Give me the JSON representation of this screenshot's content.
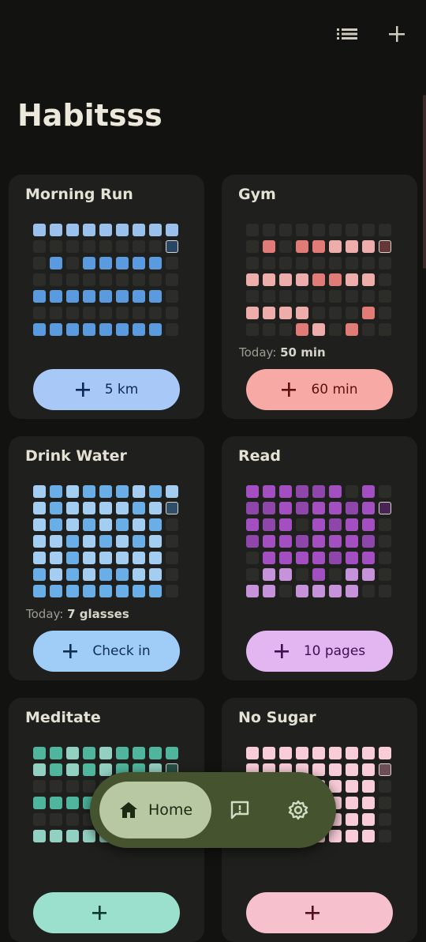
{
  "app": {
    "title": "Habitsss"
  },
  "toolbar": {
    "list_icon": "list-icon",
    "add_icon": "plus-icon"
  },
  "today_label": "Today:",
  "habits": [
    {
      "name": "Morning Run",
      "color": "#5a9be0",
      "button_label": "5 km",
      "button_bg": "#a8c8f8",
      "button_fg": "#0f2a52",
      "today_value": "",
      "grid": [
        [
          3,
          3,
          3,
          3,
          3,
          3,
          3,
          3,
          3
        ],
        [
          0,
          0,
          0,
          0,
          0,
          0,
          0,
          0,
          9
        ],
        [
          0,
          2,
          0,
          2,
          2,
          2,
          2,
          2,
          0
        ],
        [
          0,
          0,
          0,
          0,
          0,
          0,
          0,
          0,
          0
        ],
        [
          2,
          2,
          2,
          2,
          2,
          2,
          2,
          2,
          0
        ],
        [
          0,
          0,
          0,
          0,
          0,
          0,
          0,
          0,
          0
        ],
        [
          2,
          2,
          2,
          2,
          2,
          2,
          2,
          2,
          0
        ]
      ]
    },
    {
      "name": "Gym",
      "color": "#e07b78",
      "button_label": "60 min",
      "button_bg": "#f7aaa5",
      "button_fg": "#5c1210",
      "today_value": "50 min",
      "grid": [
        [
          0,
          0,
          0,
          0,
          0,
          0,
          0,
          0,
          0
        ],
        [
          0,
          2,
          0,
          2,
          2,
          3,
          3,
          3,
          9
        ],
        [
          0,
          0,
          0,
          0,
          0,
          0,
          0,
          0,
          0
        ],
        [
          3,
          3,
          3,
          3,
          2,
          2,
          3,
          3,
          0
        ],
        [
          0,
          0,
          0,
          0,
          0,
          0,
          0,
          0,
          0
        ],
        [
          3,
          3,
          3,
          3,
          0,
          0,
          0,
          2,
          0
        ],
        [
          0,
          0,
          0,
          2,
          3,
          0,
          2,
          0,
          0
        ]
      ]
    },
    {
      "name": "Drink Water",
      "color": "#6aaee8",
      "button_label": "Check in",
      "button_bg": "#9fcdf7",
      "button_fg": "#0e2f52",
      "today_value": "7 glasses",
      "grid": [
        [
          3,
          2,
          3,
          2,
          2,
          2,
          3,
          2,
          3
        ],
        [
          3,
          2,
          3,
          3,
          3,
          3,
          2,
          3,
          9
        ],
        [
          3,
          2,
          3,
          2,
          3,
          2,
          3,
          2,
          0
        ],
        [
          3,
          3,
          2,
          3,
          2,
          3,
          2,
          3,
          0
        ],
        [
          3,
          3,
          2,
          3,
          3,
          3,
          3,
          3,
          0
        ],
        [
          2,
          3,
          2,
          3,
          2,
          2,
          3,
          3,
          0
        ],
        [
          2,
          2,
          2,
          2,
          2,
          2,
          2,
          2,
          0
        ]
      ]
    },
    {
      "name": "Read",
      "color": "#a34fc2",
      "button_label": "10 pages",
      "button_bg": "#e3b6f2",
      "button_fg": "#3f0f52",
      "today_value": "",
      "grid": [
        [
          2,
          2,
          2,
          1,
          1,
          2,
          0,
          2,
          0
        ],
        [
          1,
          1,
          2,
          1,
          2,
          2,
          1,
          2,
          9
        ],
        [
          2,
          1,
          2,
          0,
          2,
          1,
          2,
          2,
          0
        ],
        [
          1,
          2,
          2,
          1,
          2,
          2,
          2,
          1,
          0
        ],
        [
          0,
          2,
          2,
          2,
          2,
          1,
          2,
          2,
          0
        ],
        [
          0,
          3,
          3,
          0,
          2,
          0,
          3,
          3,
          0
        ],
        [
          3,
          3,
          0,
          3,
          3,
          3,
          3,
          0,
          0
        ]
      ]
    },
    {
      "name": "Meditate",
      "color": "#4fb59d",
      "button_label": "",
      "button_bg": "#9be0cd",
      "button_fg": "#0f3a30",
      "today_value": "",
      "grid": [
        [
          2,
          2,
          3,
          2,
          3,
          2,
          2,
          2,
          2
        ],
        [
          3,
          2,
          3,
          2,
          3,
          2,
          2,
          3,
          9
        ],
        [
          0,
          0,
          0,
          0,
          0,
          0,
          0,
          0,
          0
        ],
        [
          2,
          2,
          2,
          2,
          2,
          2,
          2,
          2,
          0
        ],
        [
          0,
          0,
          0,
          0,
          0,
          0,
          0,
          0,
          0
        ],
        [
          3,
          3,
          3,
          3,
          3,
          3,
          3,
          3,
          0
        ]
      ]
    },
    {
      "name": "No Sugar",
      "color": "#f5aec0",
      "button_label": "",
      "button_bg": "#f7c0cd",
      "button_fg": "#521020",
      "today_value": "",
      "grid": [
        [
          3,
          3,
          3,
          3,
          3,
          3,
          3,
          3,
          3
        ],
        [
          3,
          3,
          3,
          3,
          3,
          3,
          3,
          3,
          9
        ],
        [
          3,
          3,
          3,
          3,
          3,
          3,
          3,
          3,
          0
        ],
        [
          3,
          3,
          3,
          3,
          3,
          3,
          3,
          3,
          0
        ],
        [
          3,
          3,
          3,
          3,
          3,
          3,
          3,
          3,
          0
        ],
        [
          3,
          3,
          3,
          3,
          3,
          3,
          3,
          3,
          0
        ]
      ]
    }
  ],
  "nav": {
    "home_label": "Home",
    "home_icon": "home-icon",
    "feedback_icon": "feedback-icon",
    "settings_icon": "settings-icon"
  }
}
